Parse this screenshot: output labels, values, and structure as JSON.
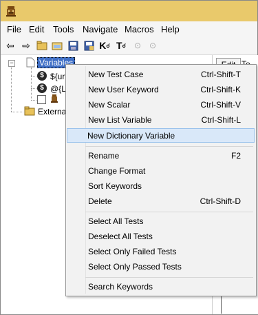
{
  "menubar": {
    "items": [
      "File",
      "Edit",
      "Tools",
      "Navigate",
      "Macros",
      "Help"
    ]
  },
  "toolbar": {
    "back_icon": "arrow-left-icon",
    "forward_icon": "arrow-right-icon",
    "open_icon": "open-folder-icon",
    "open_dir_icon": "open-directory-icon",
    "save_icon": "save-icon",
    "save_all_icon": "save-all-icon",
    "k_label": "K",
    "t_label": "T"
  },
  "tree": {
    "selected": "Variables",
    "var1": "${ur",
    "var2": "@{L",
    "external": "Externa"
  },
  "right": {
    "edit_tab": "Edit",
    "tex_tab": "Te"
  },
  "context_menu": {
    "items": [
      {
        "label": "New Test Case",
        "shortcut": "Ctrl-Shift-T"
      },
      {
        "label": "New User Keyword",
        "shortcut": "Ctrl-Shift-K"
      },
      {
        "label": "New Scalar",
        "shortcut": "Ctrl-Shift-V"
      },
      {
        "label": "New List Variable",
        "shortcut": "Ctrl-Shift-L"
      },
      {
        "label": "New Dictionary Variable",
        "shortcut": ""
      },
      {
        "label": "Rename",
        "shortcut": "F2"
      },
      {
        "label": "Change Format",
        "shortcut": ""
      },
      {
        "label": "Sort Keywords",
        "shortcut": ""
      },
      {
        "label": "Delete",
        "shortcut": "Ctrl-Shift-D"
      },
      {
        "label": "Select All Tests",
        "shortcut": ""
      },
      {
        "label": "Deselect All Tests",
        "shortcut": ""
      },
      {
        "label": "Select Only Failed Tests",
        "shortcut": ""
      },
      {
        "label": "Select Only Passed Tests",
        "shortcut": ""
      },
      {
        "label": "Search Keywords",
        "shortcut": ""
      }
    ]
  }
}
